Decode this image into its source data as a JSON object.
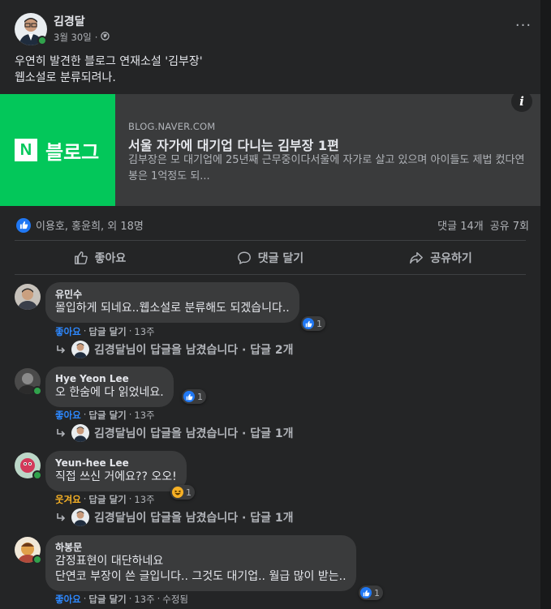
{
  "post": {
    "author": "김경달",
    "date": "3월 30일",
    "separator": "·",
    "text_line1": "우연히 발견한 블로그 연재소설 '김부장'",
    "text_line2": "웹소설로 분류되려나.",
    "more_label": "···"
  },
  "link": {
    "thumb_letter": "N",
    "thumb_word": "블로그",
    "domain": "BLOG.NAVER.COM",
    "title": "서울 자가에 대기업 다니는 김부장 1편",
    "description": "김부장은 모 대기업에 25년째 근무중이다서울에 자가로 살고 있으며 아이들도 제법 컸다연봉은 1억정도 되...",
    "info_label": "i",
    "brand_color": "#03c75a"
  },
  "reactions": {
    "summary": "이용호, 홍윤희, 외 18명",
    "comments": "댓글 14개",
    "shares": "공유 7회"
  },
  "actions": {
    "like": "좋아요",
    "comment": "댓글 달기",
    "share": "공유하기"
  },
  "comments": [
    {
      "name": "유민수",
      "text": "몰입하게 되네요..웹소설로 분류해도 되겠습니다..",
      "reaction_label": "좋아요",
      "reply_label": "답글 달기",
      "time": "13주",
      "reaction_count": "1",
      "replies_summary": "김경달님이 답글을 남겼습니다 · 답글 2개"
    },
    {
      "name": "Hye Yeon Lee",
      "text": "오 한숨에 다 읽었네요.",
      "reaction_label": "좋아요",
      "reply_label": "답글 달기",
      "time": "13주",
      "reaction_count": "1",
      "replies_summary": "김경달님이 답글을 남겼습니다 · 답글 1개"
    },
    {
      "name": "Yeun-hee Lee",
      "text": "직접 쓰신 거에요?? 오오!",
      "reaction_label": "웃겨요",
      "reply_label": "답글 달기",
      "time": "13주",
      "reaction_count": "1",
      "replies_summary": "김경달님이 답글을 남겼습니다 · 답글 1개"
    },
    {
      "name": "하봉문",
      "text_line1": "감정표현이 대단하네요",
      "text_line2": "단연코 부장이 쓴 글입니다.. 그것도 대기업.. 월급 많이 받는..",
      "reaction_label": "좋아요",
      "reply_label": "답글 달기",
      "time": "13주",
      "edited": "수정됨",
      "reaction_count": "1"
    }
  ],
  "colors": {
    "like_blue": "#2078f4",
    "haha_yellow": "#f7b125",
    "online_green": "#31a24c"
  }
}
